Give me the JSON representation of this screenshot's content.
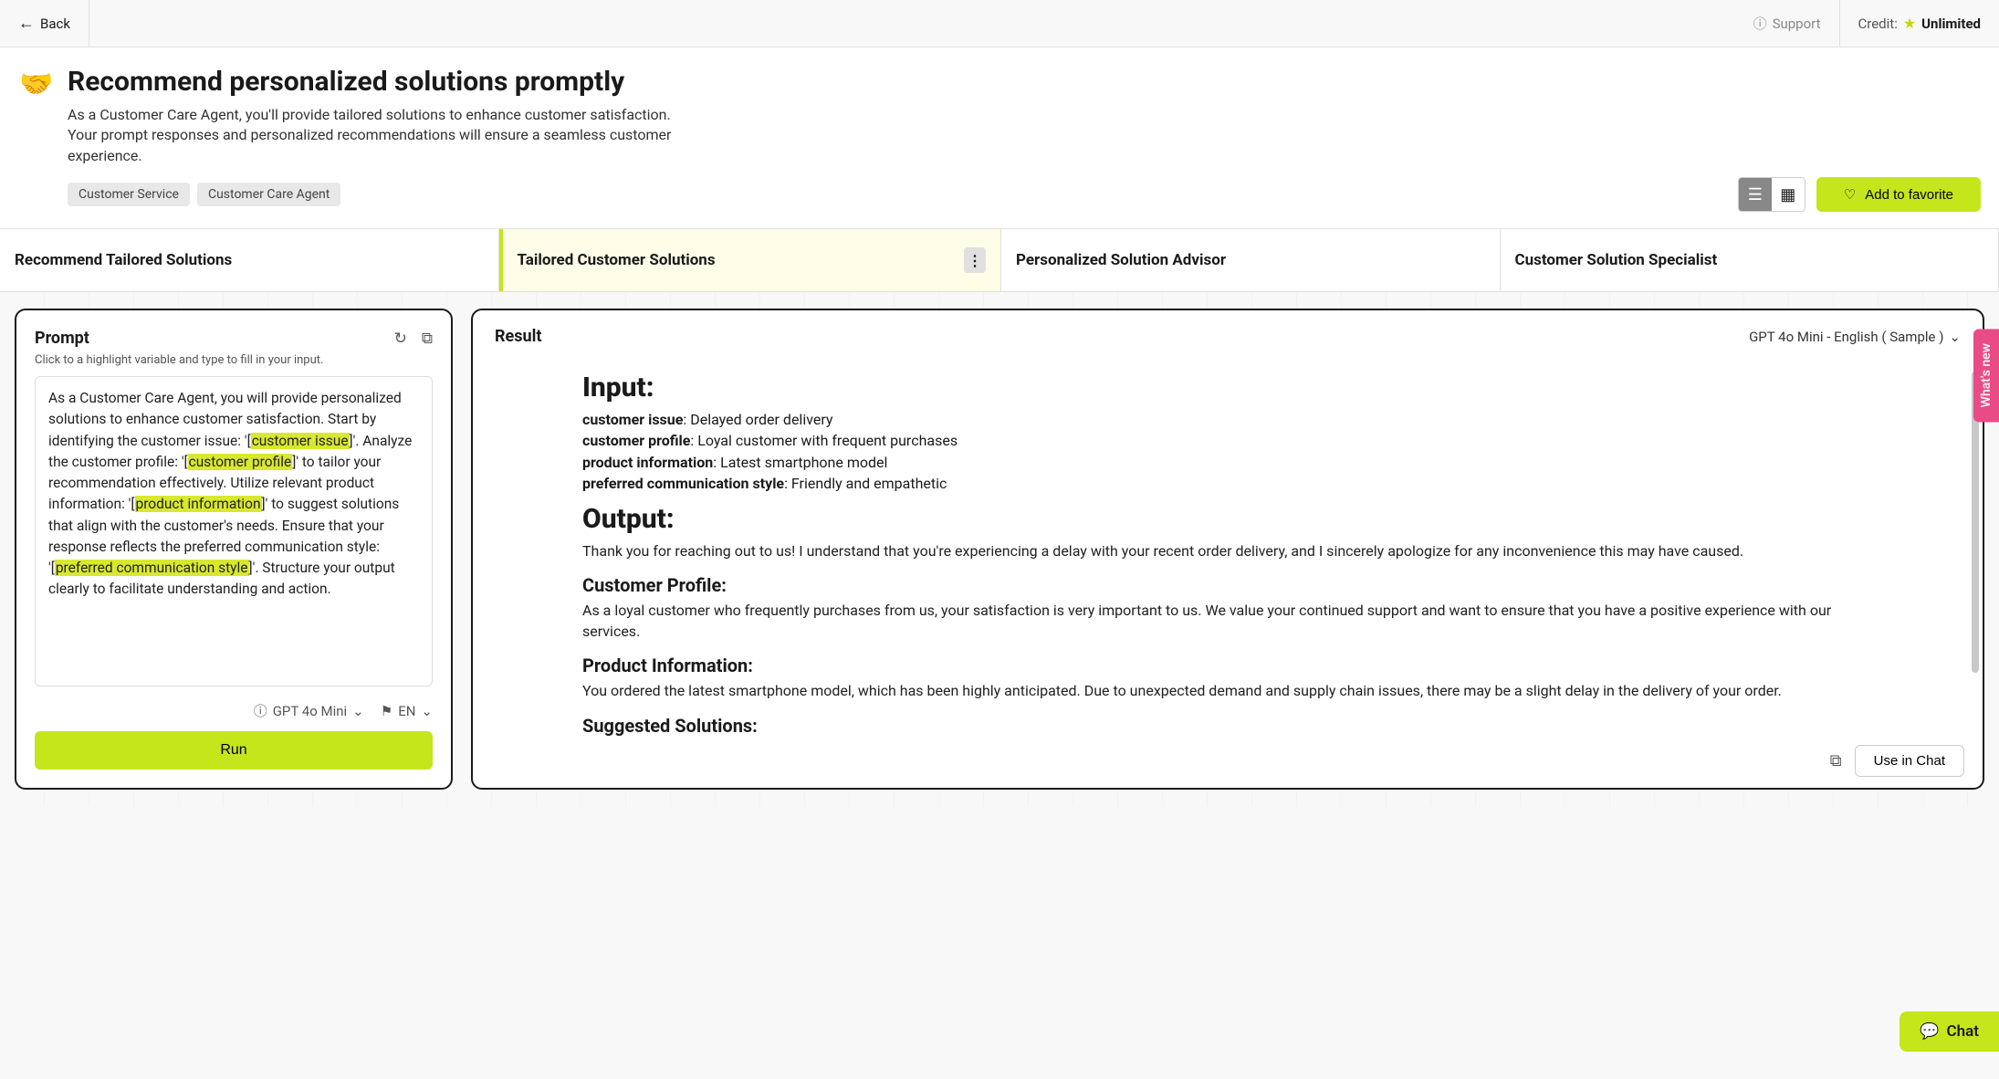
{
  "topbar": {
    "back": "Back",
    "support": "Support",
    "credit_label": "Credit:",
    "credit_value": "Unlimited"
  },
  "header": {
    "title": "Recommend personalized solutions promptly",
    "description": "As a Customer Care Agent, you'll provide tailored solutions to enhance customer satisfaction. Your prompt responses and personalized recommendations will ensure a seamless customer experience.",
    "tags": [
      "Customer Service",
      "Customer Care Agent"
    ],
    "favorite_btn": "Add to favorite"
  },
  "tabs": [
    {
      "label": "Recommend Tailored Solutions"
    },
    {
      "label": "Tailored Customer Solutions"
    },
    {
      "label": "Personalized Solution Advisor"
    },
    {
      "label": "Customer Solution Specialist"
    }
  ],
  "prompt": {
    "title": "Prompt",
    "hint": "Click to a highlight variable and type to fill in your input.",
    "text_parts": {
      "p1": "As a Customer Care Agent, you will provide personalized solutions to enhance customer satisfaction. Start by identifying the customer issue: '[",
      "v1": "customer issue",
      "p2": "]'. Analyze the customer profile: '[",
      "v2": "customer profile",
      "p3": "]' to tailor your recommendation effectively. Utilize relevant product information: '[",
      "v3": "product information",
      "p4": "]' to suggest solutions that align with the customer's needs. Ensure that your response reflects the preferred communication style: '[",
      "v4": "preferred communication style",
      "p5": "]'. Structure your output clearly to facilitate understanding and action."
    },
    "model": "GPT 4o Mini",
    "lang": "EN",
    "run_btn": "Run"
  },
  "result": {
    "title": "Result",
    "model_display": "GPT 4o Mini - English ( Sample )",
    "input_heading": "Input:",
    "inputs": {
      "k1": "customer issue",
      "v1": "Delayed order delivery",
      "k2": "customer profile",
      "v2": "Loyal customer with frequent purchases",
      "k3": "product information",
      "v3": "Latest smartphone model",
      "k4": "preferred communication style",
      "v4": "Friendly and empathetic"
    },
    "output_heading": "Output:",
    "output_intro": "Thank you for reaching out to us! I understand that you're experiencing a delay with your recent order delivery, and I sincerely apologize for any inconvenience this may have caused.",
    "sec1_h": "Customer Profile:",
    "sec1_p": "As a loyal customer who frequently purchases from us, your satisfaction is very important to us. We value your continued support and want to ensure that you have a positive experience with our services.",
    "sec2_h": "Product Information:",
    "sec2_p": "You ordered the latest smartphone model, which has been highly anticipated. Due to unexpected demand and supply chain issues, there may be a slight delay in the delivery of your order.",
    "sec3_h": "Suggested Solutions:",
    "use_in_chat": "Use in Chat"
  },
  "sidebar": {
    "whats_new": "What's new",
    "chat": "Chat"
  }
}
